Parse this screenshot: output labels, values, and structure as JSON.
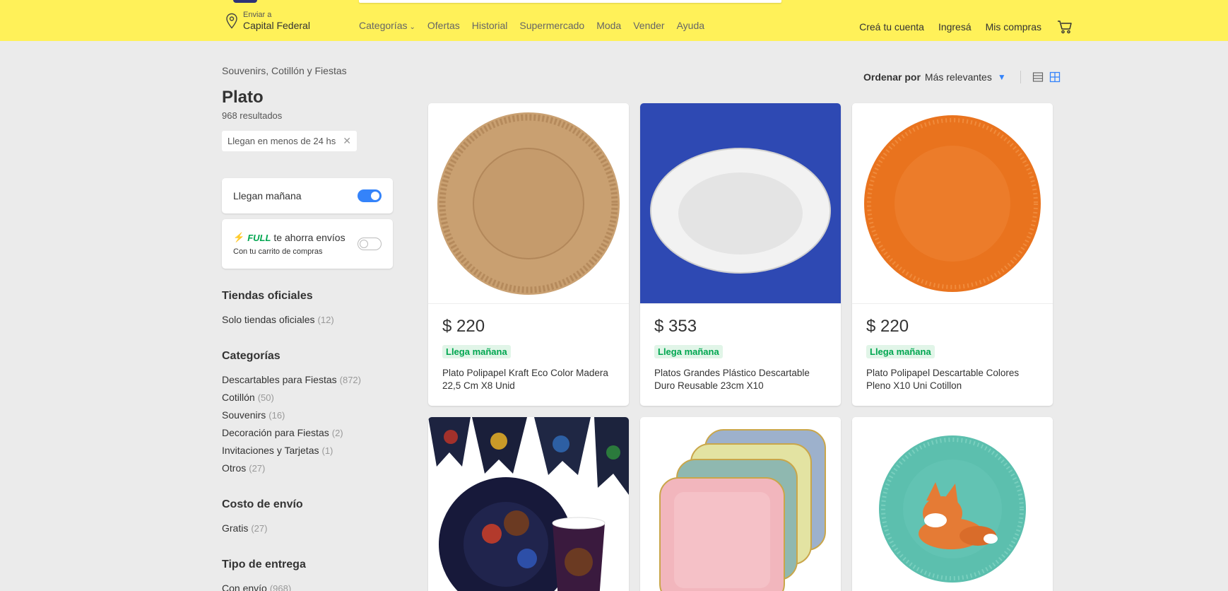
{
  "header": {
    "location_small": "Enviar a",
    "location_big": "Capital Federal",
    "nav": [
      "Categorías",
      "Ofertas",
      "Historial",
      "Supermercado",
      "Moda",
      "Vender",
      "Ayuda"
    ],
    "account": [
      "Creá tu cuenta",
      "Ingresá",
      "Mis compras"
    ]
  },
  "sidebar": {
    "breadcrumb": "Souvenirs, Cotillón y Fiestas",
    "title": "Plato",
    "results": "968 resultados",
    "chip": "Llegan en menos de 24 hs",
    "toggle_tomorrow": "Llegan mañana",
    "full_logo": "FULL",
    "full_text": "te ahorra envíos",
    "full_sub": "Con tu carrito de compras",
    "sections": [
      {
        "title": "Tiendas oficiales",
        "items": [
          {
            "label": "Solo tiendas oficiales",
            "count": "(12)"
          }
        ]
      },
      {
        "title": "Categorías",
        "items": [
          {
            "label": "Descartables para Fiestas",
            "count": "(872)"
          },
          {
            "label": "Cotillón",
            "count": "(50)"
          },
          {
            "label": "Souvenirs",
            "count": "(16)"
          },
          {
            "label": "Decoración para Fiestas",
            "count": "(2)"
          },
          {
            "label": "Invitaciones y Tarjetas",
            "count": "(1)"
          },
          {
            "label": "Otros",
            "count": "(27)"
          }
        ]
      },
      {
        "title": "Costo de envío",
        "items": [
          {
            "label": "Gratis",
            "count": "(27)"
          }
        ]
      },
      {
        "title": "Tipo de entrega",
        "items": [
          {
            "label": "Con envío",
            "count": "(968)"
          }
        ]
      }
    ]
  },
  "sort": {
    "label": "Ordenar por",
    "value": "Más relevantes"
  },
  "products": [
    {
      "price": "$ 220",
      "badge": "Llega mañana",
      "title": "Plato Polipapel Kraft Eco Color Madera 22,5 Cm X8 Unid"
    },
    {
      "price": "$ 353",
      "badge": "Llega mañana",
      "title": "Platos Grandes Plástico Descartable Duro Reusable 23cm X10"
    },
    {
      "price": "$ 220",
      "badge": "Llega mañana",
      "title": "Plato Polipapel Descartable Colores Pleno X10 Uni Cotillon"
    }
  ],
  "colors": {
    "header": "#fff159",
    "accent": "#3483fa",
    "green": "#00a650"
  }
}
